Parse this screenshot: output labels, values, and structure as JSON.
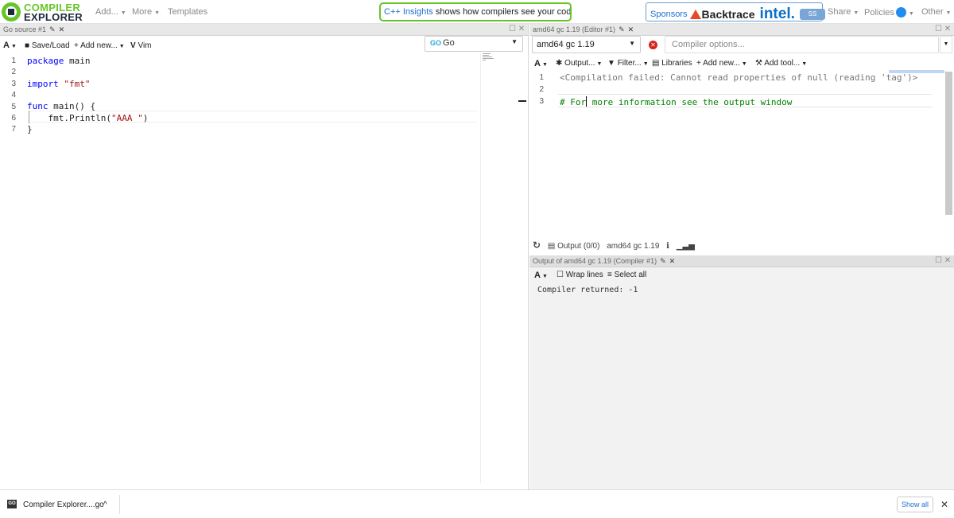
{
  "nav": {
    "logo_top": "COMPILER",
    "logo_bottom": "EXPLORER",
    "add": "Add...",
    "more": "More",
    "templates": "Templates",
    "insights_highlight": "C++ Insights",
    "insights_rest": "shows how compilers see your code",
    "insights_close": "×",
    "sponsors": "Sponsors",
    "sponsor_backtrace": "Backtrace",
    "sponsor_intel": "intel.",
    "sponsor_solid": "Solid Sands",
    "share": "Share",
    "policies": "Policies",
    "other": "Other"
  },
  "editor_pane": {
    "tab_title": "Go source #1",
    "font_menu": "A",
    "save_load": "Save/Load",
    "add_new": "Add new...",
    "vim": "Vim",
    "language": "Go",
    "lines": [
      {
        "n": "1",
        "text": "package main"
      },
      {
        "n": "2",
        "text": ""
      },
      {
        "n": "3",
        "text": "import \"fmt\""
      },
      {
        "n": "4",
        "text": ""
      },
      {
        "n": "5",
        "text": "func main() {"
      },
      {
        "n": "6",
        "text": "    fmt.Println(\"AAA \")"
      },
      {
        "n": "7",
        "text": "}"
      }
    ]
  },
  "compiler_pane": {
    "tab_title": "amd64 gc 1.19 (Editor #1)",
    "compiler": "amd64 gc 1.19",
    "options_placeholder": "Compiler options...",
    "font_menu": "A",
    "output_menu": "Output...",
    "filter_menu": "Filter...",
    "libraries": "Libraries",
    "add_new": "Add new...",
    "add_tool": "Add tool...",
    "asm_lines": [
      {
        "n": "1",
        "text": "<Compilation failed: Cannot read properties of null (reading 'tag')>"
      },
      {
        "n": "2",
        "text": ""
      },
      {
        "n": "3",
        "text": "# For more information see the output window"
      }
    ],
    "status_output": "Output (0/0)",
    "status_compiler": "amd64 gc 1.19"
  },
  "output_pane": {
    "tab_title": "Output of amd64 gc 1.19 (Compiler #1)",
    "font_menu": "A",
    "wrap_lines": "Wrap lines",
    "select_all": "Select all",
    "text": "Compiler returned: -1"
  },
  "downloads": {
    "file": "Compiler Explorer....go",
    "show_all": "Show all"
  },
  "colors": {
    "brand_green": "#67c52a",
    "link_blue": "#1f6fd1",
    "error_red": "#d9211c"
  }
}
